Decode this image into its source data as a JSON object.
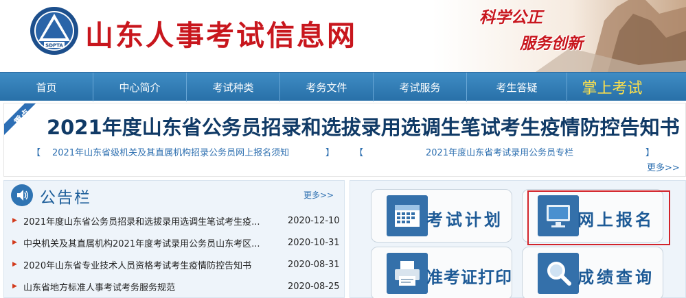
{
  "header": {
    "logo_text": "SDPTA",
    "site_name": "山东人事考试信息网",
    "slogan_line1": "科学公正",
    "slogan_line2": "服务创新"
  },
  "nav": {
    "items": [
      "首页",
      "中心简介",
      "考试种类",
      "考务文件",
      "考试服务",
      "考生答疑",
      "掌上考试"
    ]
  },
  "headline": {
    "badge": "重点",
    "title": "2021年度山东省公务员招录和选拔录用选调生笔试考生疫情防控告知书",
    "links": [
      "2021年山东省级机关及其直属机构招录公务员网上报名须知",
      "2021年度山东省考试录用公务员专栏"
    ],
    "bracket_open": "【",
    "bracket_close": "】",
    "more": "更多>>"
  },
  "notice": {
    "title": "公告栏",
    "more": "更多>>",
    "items": [
      {
        "text": "2021年度山东省公务员招录和选拔录用选调生笔试考生疫...",
        "date": "2020-12-10"
      },
      {
        "text": "中央机关及其直属机构2021年度考试录用公务员山东考区...",
        "date": "2020-10-31"
      },
      {
        "text": "2020年山东省专业技术人员资格考试考生疫情防控告知书",
        "date": "2020-08-31"
      },
      {
        "text": "山东省地方标准人事考试考务服务规范",
        "date": "2020-08-25"
      }
    ]
  },
  "services": {
    "plan": "考试计划",
    "register": "网上报名",
    "ticket": "准考证打印",
    "score": "成绩查询"
  },
  "colors": {
    "brand_red": "#c8161d",
    "nav_blue": "#2f7ab8",
    "headline_blue": "#103a66",
    "highlight": "#d2232a"
  }
}
